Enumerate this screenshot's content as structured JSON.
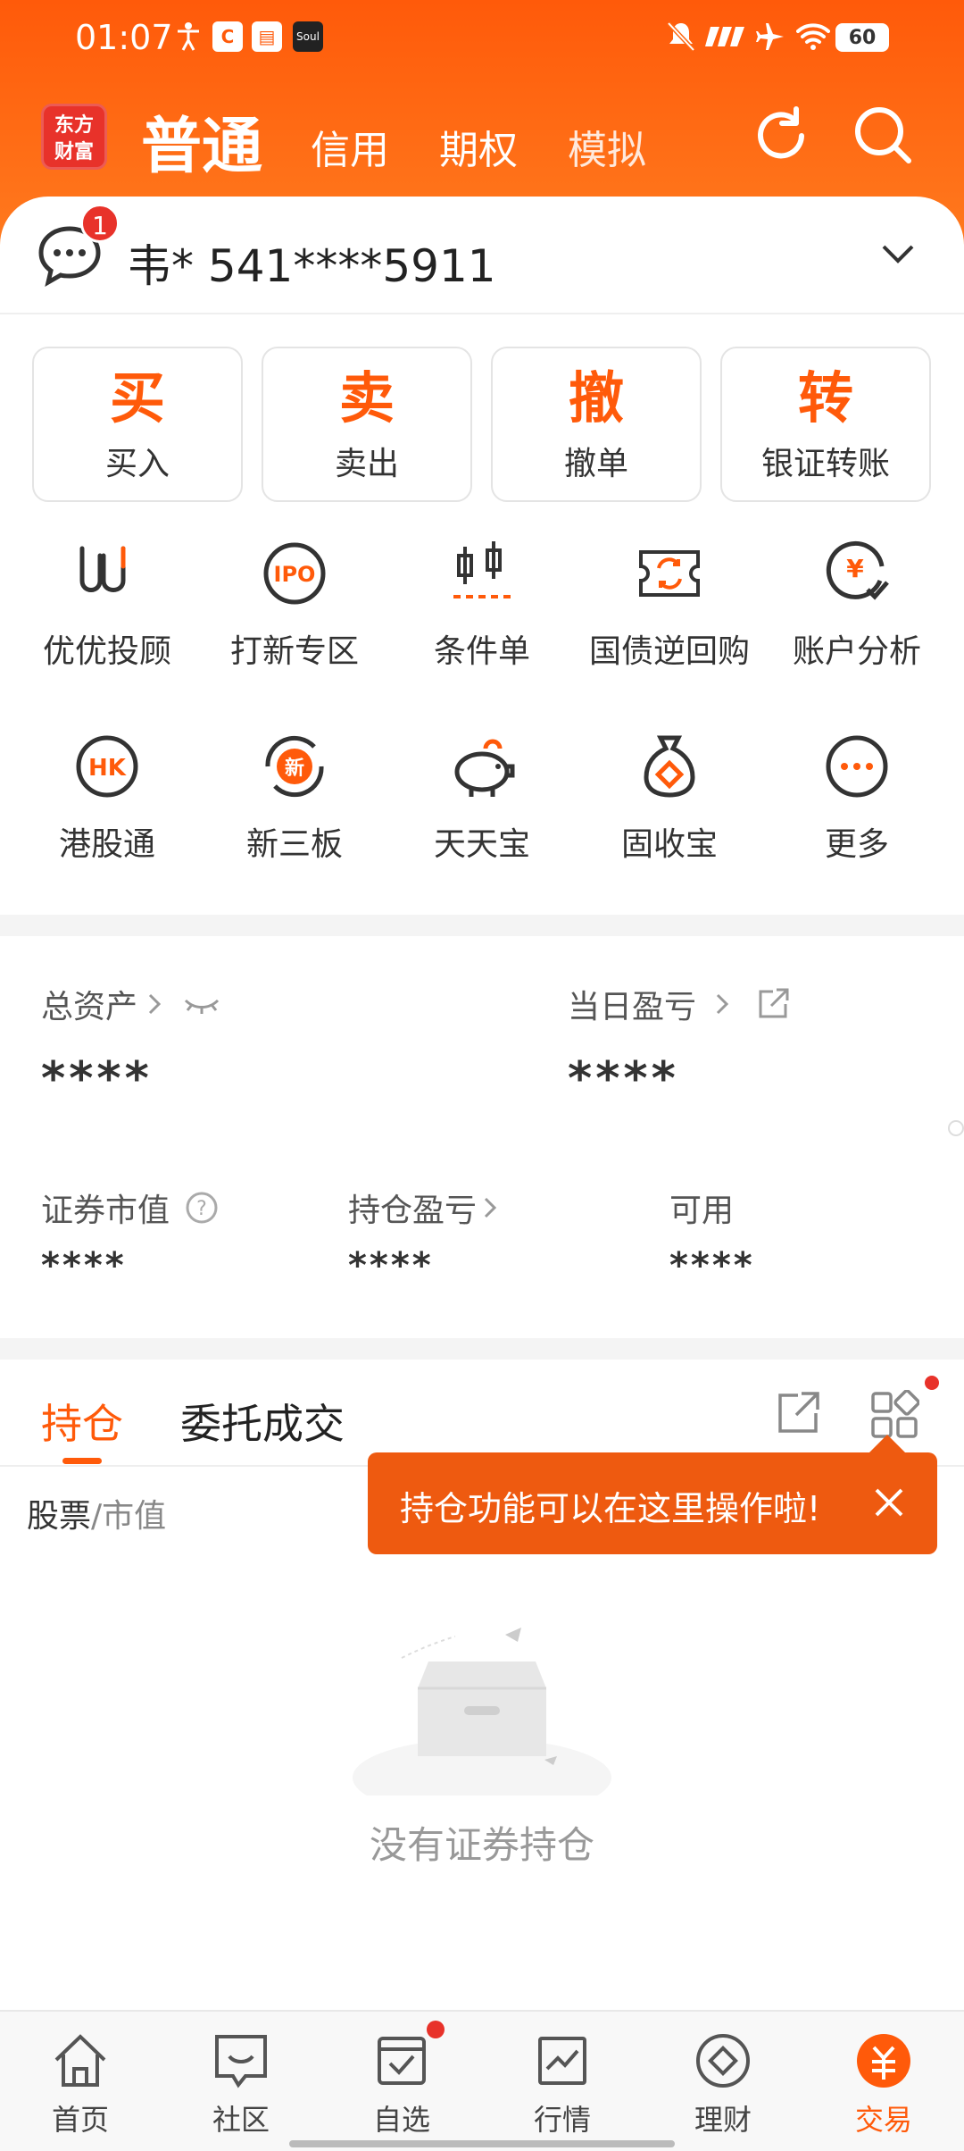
{
  "status_bar": {
    "time": "01:07",
    "battery": "60"
  },
  "header": {
    "logo_line1": "东方",
    "logo_line2": "财富",
    "tabs": [
      {
        "label": "普通"
      },
      {
        "label": "信用"
      },
      {
        "label": "期权"
      },
      {
        "label": "模拟"
      }
    ]
  },
  "account": {
    "name_id": "韦* 541****5911",
    "badge": "1"
  },
  "actions": [
    {
      "big": "买",
      "label": "买入"
    },
    {
      "big": "卖",
      "label": "卖出"
    },
    {
      "big": "撤",
      "label": "撤单"
    },
    {
      "big": "转",
      "label": "银证转账"
    }
  ],
  "grid_row1": [
    {
      "label": "优优投顾",
      "icon": "uu-icon"
    },
    {
      "label": "打新专区",
      "icon": "ipo-icon"
    },
    {
      "label": "条件单",
      "icon": "condition-order-icon"
    },
    {
      "label": "国债逆回购",
      "icon": "repo-icon"
    },
    {
      "label": "账户分析",
      "icon": "account-analysis-icon"
    }
  ],
  "grid_row2": [
    {
      "label": "港股通",
      "icon": "hk-icon"
    },
    {
      "label": "新三板",
      "icon": "new-third-board-icon"
    },
    {
      "label": "天天宝",
      "icon": "piggy-bank-icon"
    },
    {
      "label": "固收宝",
      "icon": "money-bag-icon"
    },
    {
      "label": "更多",
      "icon": "more-icon"
    }
  ],
  "assets": {
    "total_label": "总资产",
    "total_value": "****",
    "daily_label": "当日盈亏",
    "daily_value": "****",
    "market_label": "证券市值",
    "market_value": "****",
    "holding_pl_label": "持仓盈亏",
    "holding_pl_value": "****",
    "available_label": "可用",
    "available_value": "****"
  },
  "positions": {
    "tab_active": "持仓",
    "tab_other": "委托成交",
    "col_stock": "股票",
    "col_value": "/市值",
    "tooltip": "持仓功能可以在这里操作啦!",
    "empty": "没有证券持仓"
  },
  "bottom_nav": [
    {
      "label": "首页"
    },
    {
      "label": "社区"
    },
    {
      "label": "自选"
    },
    {
      "label": "行情"
    },
    {
      "label": "理财"
    },
    {
      "label": "交易"
    }
  ],
  "colors": {
    "accent": "#ff5a0a",
    "badge": "#e8322a"
  }
}
